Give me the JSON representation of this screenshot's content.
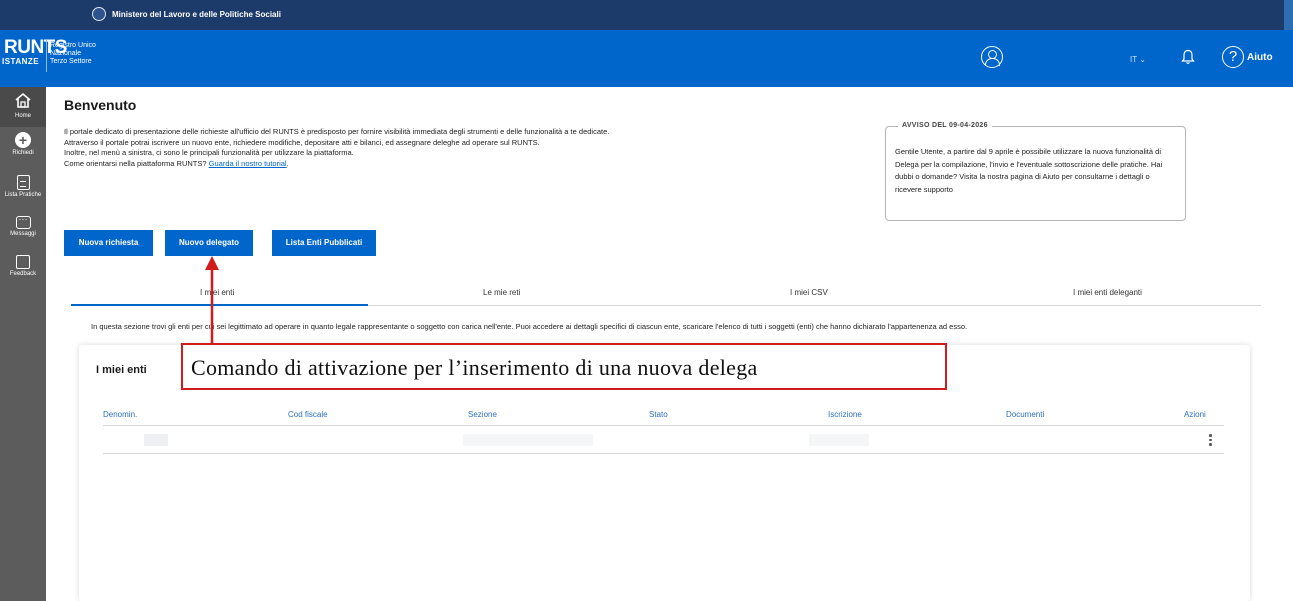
{
  "topbar": {
    "ministry": "Ministero del Lavoro e delle Politiche Sociali"
  },
  "header": {
    "logo": "RUNTS",
    "logo_sub": "ISTANZE",
    "registry_line1": "Registro Unico",
    "registry_line2": "Nazionale",
    "registry_line3": "Terzo Settore",
    "lang": "IT ⌄",
    "help": "Aiuto",
    "icons": [
      "user-icon",
      "bell-icon",
      "help-icon"
    ]
  },
  "sidebar": {
    "items": [
      {
        "label": "Home",
        "icon": "home-icon"
      },
      {
        "label": "Richiedi",
        "icon": "plus-icon"
      },
      {
        "label": "Lista Pratiche",
        "icon": "document-icon"
      },
      {
        "label": "Messaggi",
        "icon": "chat-icon"
      },
      {
        "label": "Feedback",
        "icon": "feedback-icon"
      }
    ]
  },
  "main": {
    "title": "Benvenuto",
    "intro": {
      "p1": "Il portale dedicato di presentazione delle richieste all'ufficio del RUNTS è predisposto per fornire visibilità immediata degli strumenti e delle funzionalità a te dedicate.",
      "p2": "Attraverso il portale potrai iscrivere un nuovo ente, richiedere modifiche, depositare atti e bilanci, ed assegnare deleghe ad operare sul RUNTS.",
      "p3": "Inoltre, nel menù a sinistra, ci sono le principali funzionalità per utilizzare la piattaforma.",
      "p4_text": "Come orientarsi nella piattaforma RUNTS? ",
      "p4_link": "Guarda il nostro tutorial",
      "p4_end": "."
    },
    "notice": {
      "title": "AVVISO DEL 09-04-2026",
      "body": "Gentile Utente, a partire dal 9 aprile è possibile utilizzare la nuova funzionalità di Delega per la compilazione, l'invio e l'eventuale sottoscrizione delle pratiche. Hai dubbi o domande? Visita la nostra pagina di Aiuto per consultarne i dettagli o ricevere supporto"
    },
    "buttons": {
      "new_request": "Nuova richiesta",
      "new_delegate": "Nuovo delegato",
      "public_list": "Lista Enti Pubblicati"
    },
    "tabs": [
      "I miei enti",
      "Le mie reti",
      "I miei CSV",
      "I miei enti deleganti"
    ],
    "section_desc": "In questa sezione trovi gli enti per cui sei legittimato ad operare in quanto legale rappresentante o soggetto con carica nell'ente. Puoi accedere ai dettagli specifici di ciascun ente, scaricare l'elenco di tutti i soggetti (enti) che hanno dichiarato l'appartenenza ad esso.",
    "card": {
      "title": "I miei enti",
      "columns": [
        "Denomin.",
        "Cod fiscale",
        "Sezione",
        "Stato",
        "Iscrizione",
        "Documenti",
        "Azioni"
      ]
    }
  },
  "annotation": {
    "text": "Comando di attivazione per l’inserimento di una nuova delega",
    "color": "#d11c1c"
  }
}
